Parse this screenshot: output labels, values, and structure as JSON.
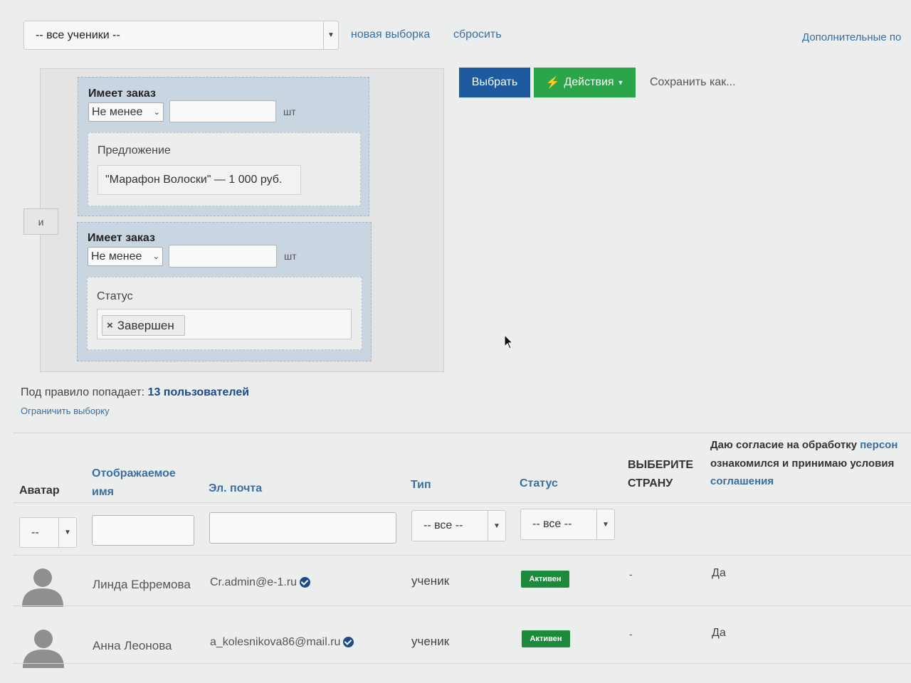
{
  "toolbar": {
    "segment_select": "-- все ученики --",
    "new_selection": "новая выборка",
    "reset": "сбросить",
    "extra_params": "Дополнительные по"
  },
  "rule": {
    "and_label": "и",
    "conditions": [
      {
        "title": "Имеет заказ",
        "operator": "Не менее",
        "count_value": "",
        "unit": "шт",
        "sub_label": "Предложение",
        "sub_value": "\"Марафон Волоски\" — 1 000 руб."
      },
      {
        "title": "Имеет заказ",
        "operator": "Не менее",
        "count_value": "",
        "unit": "шт",
        "sub_label": "Статус",
        "tag_remove": "×",
        "tag_value": "Завершен"
      }
    ]
  },
  "actions": {
    "select": "Выбрать",
    "actions_label": "Действия",
    "save_as": "Сохранить как..."
  },
  "summary": {
    "prefix": "Под правило попадает:",
    "count": "13 пользователей",
    "limit": "Ограничить выборку"
  },
  "table": {
    "headers": {
      "avatar": "Аватар",
      "display_name_1": "Отображаемое",
      "display_name_2": "имя",
      "email": "Эл. почта",
      "type": "Тип",
      "status": "Статус",
      "country_1": "ВЫБЕРИТЕ",
      "country_2": "СТРАНУ",
      "consent_1a": "Даю согласие на обработку ",
      "consent_1b": "персон",
      "consent_2": "ознакомился и принимаю условия",
      "consent_3": "соглашения"
    },
    "filters": {
      "avatar": "--",
      "type": "-- все --",
      "status": "-- все --"
    },
    "rows": [
      {
        "name": "Линда Ефремова",
        "email": "Cr.admin@e-1.ru",
        "type": "ученик",
        "status": "Активен",
        "country": "-",
        "consent": "Да"
      },
      {
        "name": "Анна Леонова",
        "email": "a_kolesnikova86@mail.ru",
        "type": "ученик",
        "status": "Активен",
        "country": "-",
        "consent": "Да"
      }
    ]
  },
  "colors": {
    "primary_blue": "#1d5a9e",
    "success_green": "#2aa54a",
    "link": "#3a6e9f"
  }
}
